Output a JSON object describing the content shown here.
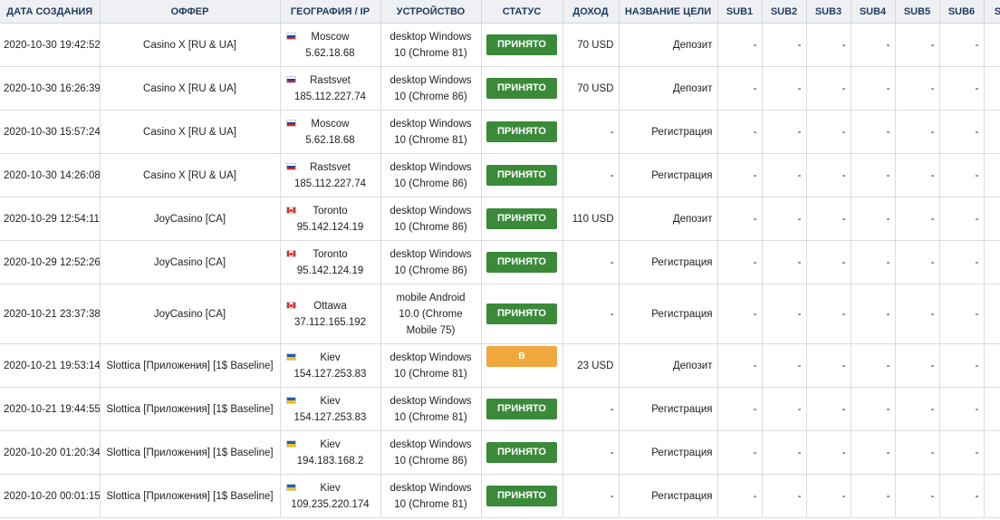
{
  "colors": {
    "accepted": "#3a8a3a",
    "pending": "#f0a83e",
    "header_bg": "#eef0f3",
    "header_text": "#1f3a5f"
  },
  "columns": [
    "ДАТА СОЗДАНИЯ",
    "ОФФЕР",
    "ГЕОГРАФИЯ / IP",
    "УСТРОЙСТВО",
    "СТАТУС",
    "ДОХОД",
    "НАЗВАНИЕ ЦЕЛИ",
    "SUB1",
    "SUB2",
    "SUB3",
    "SUB4",
    "SUB5",
    "SUB6",
    "SU"
  ],
  "rows": [
    {
      "date": "2020-10-30 19:42:52",
      "offer": "Casino X [RU & UA]",
      "flag": "ru",
      "city": "Moscow",
      "ip": "5.62.18.68",
      "device": "desktop Windows 10 (Chrome 81)",
      "status": "ПРИНЯТО",
      "status_type": "accepted",
      "income": "70 USD",
      "goal": "Депозит",
      "subs": [
        "-",
        "-",
        "-",
        "-",
        "-",
        "-",
        ""
      ],
      "height": "h48"
    },
    {
      "date": "2020-10-30 16:26:39",
      "offer": "Casino X [RU & UA]",
      "flag": "ru",
      "city": "Rastsvet",
      "ip": "185.112.227.74",
      "device": "desktop Windows 10 (Chrome 86)",
      "status": "ПРИНЯТО",
      "status_type": "accepted",
      "income": "70 USD",
      "goal": "Депозит",
      "subs": [
        "-",
        "-",
        "-",
        "-",
        "-",
        "-",
        ""
      ],
      "height": "h48"
    },
    {
      "date": "2020-10-30 15:57:24",
      "offer": "Casino X [RU & UA]",
      "flag": "ru",
      "city": "Moscow",
      "ip": "5.62.18.68",
      "device": "desktop Windows 10 (Chrome 81)",
      "status": "ПРИНЯТО",
      "status_type": "accepted",
      "income": "-",
      "goal": "Регистрация",
      "subs": [
        "-",
        "-",
        "-",
        "-",
        "-",
        "-",
        ""
      ],
      "height": "h48"
    },
    {
      "date": "2020-10-30 14:26:08",
      "offer": "Casino X [RU & UA]",
      "flag": "ru",
      "city": "Rastsvet",
      "ip": "185.112.227.74",
      "device": "desktop Windows 10 (Chrome 86)",
      "status": "ПРИНЯТО",
      "status_type": "accepted",
      "income": "-",
      "goal": "Регистрация",
      "subs": [
        "-",
        "-",
        "-",
        "-",
        "-",
        "-",
        ""
      ],
      "height": "h48"
    },
    {
      "date": "2020-10-29 12:54:11",
      "offer": "JoyCasino [CA]",
      "flag": "ca",
      "city": "Toronto",
      "ip": "95.142.124.19",
      "device": "desktop Windows 10 (Chrome 86)",
      "status": "ПРИНЯТО",
      "status_type": "accepted",
      "income": "110 USD",
      "goal": "Депозит",
      "subs": [
        "-",
        "-",
        "-",
        "-",
        "-",
        "-",
        ""
      ],
      "height": "h48"
    },
    {
      "date": "2020-10-29 12:52:26",
      "offer": "JoyCasino [CA]",
      "flag": "ca",
      "city": "Toronto",
      "ip": "95.142.124.19",
      "device": "desktop Windows 10 (Chrome 86)",
      "status": "ПРИНЯТО",
      "status_type": "accepted",
      "income": "-",
      "goal": "Регистрация",
      "subs": [
        "-",
        "-",
        "-",
        "-",
        "-",
        "-",
        ""
      ],
      "height": "h48"
    },
    {
      "date": "2020-10-21 23:37:38",
      "offer": "JoyCasino [CA]",
      "flag": "ca",
      "city": "Ottawa",
      "ip": "37.112.165.192",
      "device": "mobile Android 10.0 (Chrome Mobile 75)",
      "status": "ПРИНЯТО",
      "status_type": "accepted",
      "income": "-",
      "goal": "Регистрация",
      "subs": [
        "-",
        "-",
        "-",
        "-",
        "-",
        "-",
        ""
      ],
      "height": "h65"
    },
    {
      "date": "2020-10-21 19:53:14",
      "offer": "Slottica [Приложения] [1$ Baseline]",
      "flag": "ua",
      "city": "Kiev",
      "ip": "154.127.253.83",
      "device": "desktop Windows 10 (Chrome 81)",
      "status": "В ОБРАБОТКЕ",
      "status_type": "pending",
      "income": "23 USD",
      "goal": "Депозит",
      "subs": [
        "-",
        "-",
        "-",
        "-",
        "-",
        "-",
        ""
      ],
      "height": "h48"
    },
    {
      "date": "2020-10-21 19:44:55",
      "offer": "Slottica [Приложения] [1$ Baseline]",
      "flag": "ua",
      "city": "Kiev",
      "ip": "154.127.253.83",
      "device": "desktop Windows 10 (Chrome 81)",
      "status": "ПРИНЯТО",
      "status_type": "accepted",
      "income": "-",
      "goal": "Регистрация",
      "subs": [
        "-",
        "-",
        "-",
        "-",
        "-",
        "-",
        ""
      ],
      "height": "h48"
    },
    {
      "date": "2020-10-20 01:20:34",
      "offer": "Slottica [Приложения] [1$ Baseline]",
      "flag": "ua",
      "city": "Kiev",
      "ip": "194.183.168.2",
      "device": "desktop Windows 10 (Chrome 86)",
      "status": "ПРИНЯТО",
      "status_type": "accepted",
      "income": "-",
      "goal": "Регистрация",
      "subs": [
        "-",
        "-",
        "-",
        "-",
        "-",
        "-",
        ""
      ],
      "height": "h48"
    },
    {
      "date": "2020-10-20 00:01:15",
      "offer": "Slottica [Приложения] [1$ Baseline]",
      "flag": "ua",
      "city": "Kiev",
      "ip": "109.235.220.174",
      "device": "desktop Windows 10 (Chrome 81)",
      "status": "ПРИНЯТО",
      "status_type": "accepted",
      "income": "-",
      "goal": "Регистрация",
      "subs": [
        "-",
        "-",
        "-",
        "-",
        "-",
        "-",
        ""
      ],
      "height": "h48"
    }
  ]
}
